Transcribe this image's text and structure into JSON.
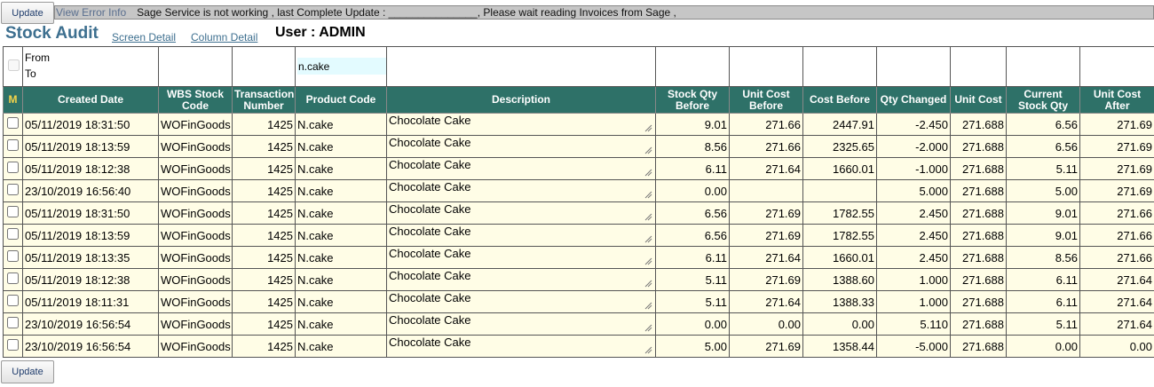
{
  "toolbar": {
    "update_label": "Update",
    "view_error_label": "View Error Info",
    "status_message": "Sage Service is not working , last Complete Update : _______________, Please wait reading Invoices from Sage ,"
  },
  "header": {
    "title": "Stock Audit",
    "screen_detail_link": "Screen Detail",
    "column_detail_link": "Column Detail",
    "user_label": "User : ",
    "user_name": "ADMIN"
  },
  "filter": {
    "from_label": "From",
    "to_label": "To",
    "product_code_value": "n.cake"
  },
  "table": {
    "columns": [
      "M",
      "Created Date",
      "WBS Stock Code",
      "Transaction Number",
      "Product Code",
      "Description",
      "Stock Qty Before",
      "Unit Cost Before",
      "Cost Before",
      "Qty Changed",
      "Unit Cost",
      "Current Stock Qty",
      "Unit Cost After"
    ],
    "rows": [
      [
        "05/11/2019 18:31:50",
        "WOFinGoods",
        "1425",
        "N.cake",
        "Chocolate Cake",
        "9.01",
        "271.66",
        "2447.91",
        "-2.450",
        "271.688",
        "6.56",
        "271.69"
      ],
      [
        "05/11/2019 18:13:59",
        "WOFinGoods",
        "1425",
        "N.cake",
        "Chocolate Cake",
        "8.56",
        "271.66",
        "2325.65",
        "-2.000",
        "271.688",
        "6.56",
        "271.69"
      ],
      [
        "05/11/2019 18:12:38",
        "WOFinGoods",
        "1425",
        "N.cake",
        "Chocolate Cake",
        "6.11",
        "271.64",
        "1660.01",
        "-1.000",
        "271.688",
        "5.11",
        "271.69"
      ],
      [
        "23/10/2019 16:56:40",
        "WOFinGoods",
        "1425",
        "N.cake",
        "Chocolate Cake",
        "0.00",
        "",
        "",
        "5.000",
        "271.688",
        "5.00",
        "271.69"
      ],
      [
        "05/11/2019 18:31:50",
        "WOFinGoods",
        "1425",
        "N.cake",
        "Chocolate Cake",
        "6.56",
        "271.69",
        "1782.55",
        "2.450",
        "271.688",
        "9.01",
        "271.66"
      ],
      [
        "05/11/2019 18:13:59",
        "WOFinGoods",
        "1425",
        "N.cake",
        "Chocolate Cake",
        "6.56",
        "271.69",
        "1782.55",
        "2.450",
        "271.688",
        "9.01",
        "271.66"
      ],
      [
        "05/11/2019 18:13:35",
        "WOFinGoods",
        "1425",
        "N.cake",
        "Chocolate Cake",
        "6.11",
        "271.64",
        "1660.01",
        "2.450",
        "271.688",
        "8.56",
        "271.66"
      ],
      [
        "05/11/2019 18:12:38",
        "WOFinGoods",
        "1425",
        "N.cake",
        "Chocolate Cake",
        "5.11",
        "271.69",
        "1388.60",
        "1.000",
        "271.688",
        "6.11",
        "271.64"
      ],
      [
        "05/11/2019 18:11:31",
        "WOFinGoods",
        "1425",
        "N.cake",
        "Chocolate Cake",
        "5.11",
        "271.64",
        "1388.33",
        "1.000",
        "271.688",
        "6.11",
        "271.64"
      ],
      [
        "23/10/2019 16:56:54",
        "WOFinGoods",
        "1425",
        "N.cake",
        "Chocolate Cake",
        "0.00",
        "0.00",
        "0.00",
        "5.110",
        "271.688",
        "5.11",
        "271.64"
      ],
      [
        "23/10/2019 16:56:54",
        "WOFinGoods",
        "1425",
        "N.cake",
        "Chocolate Cake",
        "5.00",
        "271.69",
        "1358.44",
        "-5.000",
        "271.688",
        "0.00",
        "0.00"
      ]
    ]
  },
  "colors": {
    "header_bg": "#2e7168",
    "row_bg": "#fffde6",
    "title": "#3d6f8f",
    "m_marker": "#f4d44a",
    "filter_input_bg": "#e3fbff"
  },
  "icons": {
    "row_select": "checkbox-icon",
    "textarea_resize": "resize-grip-icon"
  }
}
